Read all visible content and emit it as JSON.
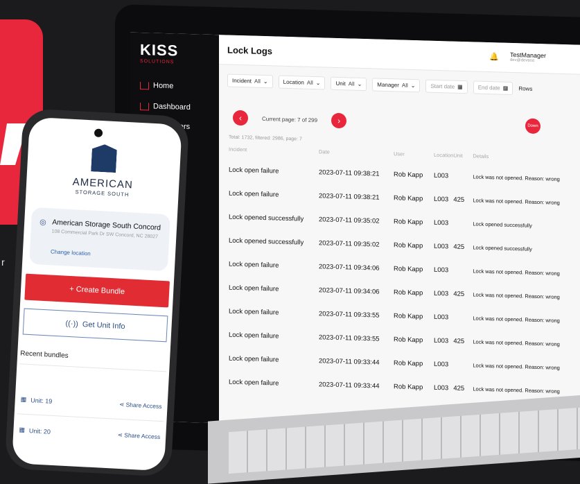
{
  "laptop": {
    "logo": "KISS",
    "logo_sub": "SOLUTIONS",
    "nav": [
      {
        "label": "Home"
      },
      {
        "label": "Dashboard"
      },
      {
        "label": "Customers"
      }
    ],
    "page_title": "Lock Logs",
    "user_name": "TestManager",
    "user_email": "dev@devtest",
    "filters": [
      {
        "label": "Incident",
        "value": "All"
      },
      {
        "label": "Location",
        "value": "All"
      },
      {
        "label": "Unit",
        "value": "All"
      },
      {
        "label": "Manager",
        "value": "All"
      }
    ],
    "start_date_placeholder": "Start date",
    "end_date_placeholder": "End date",
    "rows_label": "Rows",
    "current_page": "Current page: 7 of 299",
    "total": "Total: 1732, filtered: 2986, page: 7",
    "download_label": "Down",
    "table": {
      "headers": [
        "Incident",
        "Date",
        "User",
        "Location",
        "Unit",
        "Details"
      ],
      "rows": [
        [
          "Lock open failure",
          "2023-07-11 09:38:21",
          "Rob Kapp",
          "L003",
          "",
          "Lock was not opened. Reason: wrong"
        ],
        [
          "Lock open failure",
          "2023-07-11 09:38:21",
          "Rob Kapp",
          "L003",
          "425",
          "Lock was not opened. Reason: wrong"
        ],
        [
          "Lock opened successfully",
          "2023-07-11 09:35:02",
          "Rob Kapp",
          "L003",
          "",
          "Lock opened successfully"
        ],
        [
          "Lock opened successfully",
          "2023-07-11 09:35:02",
          "Rob Kapp",
          "L003",
          "425",
          "Lock opened successfully"
        ],
        [
          "Lock open failure",
          "2023-07-11 09:34:06",
          "Rob Kapp",
          "L003",
          "",
          "Lock was not opened. Reason: wrong"
        ],
        [
          "Lock open failure",
          "2023-07-11 09:34:06",
          "Rob Kapp",
          "L003",
          "425",
          "Lock was not opened. Reason: wrong"
        ],
        [
          "Lock open failure",
          "2023-07-11 09:33:55",
          "Rob Kapp",
          "L003",
          "",
          "Lock was not opened. Reason: wrong"
        ],
        [
          "Lock open failure",
          "2023-07-11 09:33:55",
          "Rob Kapp",
          "L003",
          "425",
          "Lock was not opened. Reason: wrong"
        ],
        [
          "Lock open failure",
          "2023-07-11 09:33:44",
          "Rob Kapp",
          "L003",
          "",
          "Lock was not opened. Reason: wrong"
        ],
        [
          "Lock open failure",
          "2023-07-11 09:33:44",
          "Rob Kapp",
          "L003",
          "425",
          "Lock was not opened. Reason: wrong"
        ]
      ]
    }
  },
  "phone": {
    "brand_name": "AMERICAN",
    "brand_sub": "STORAGE SOUTH",
    "location_name": "American Storage South Concord",
    "location_address": "108 Commercial Park Dr SW Concord, NC 28027",
    "change_location": "Change location",
    "create_bundle": "+ Create Bundle",
    "get_unit_info": "Get Unit Info",
    "recent_title": "Recent bundles",
    "bundles": [
      {
        "unit": "Unit: 19",
        "share": "Share Access"
      },
      {
        "unit": "Unit: 20",
        "share": "Share Access"
      }
    ]
  },
  "left_text": "r",
  "colors": {
    "accent": "#e8263c",
    "dark": "#0e0e10",
    "blue": "#2d4f86"
  }
}
